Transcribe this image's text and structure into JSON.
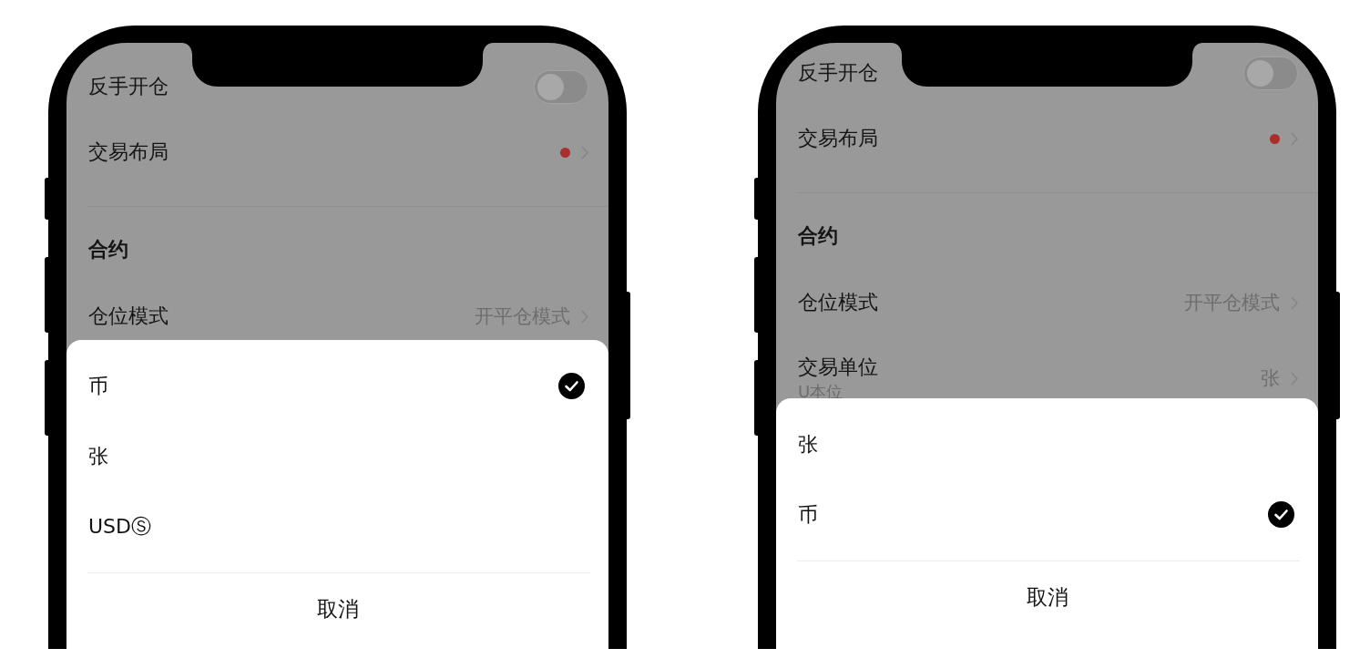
{
  "phones": [
    {
      "settings": [
        {
          "kind": "toggle",
          "label": "反手开仓",
          "on": false
        },
        {
          "kind": "link",
          "label": "交易布局",
          "dot": true
        },
        {
          "kind": "section",
          "label": "合约"
        },
        {
          "kind": "link",
          "label": "仓位模式",
          "value": "开平仓模式"
        }
      ],
      "sheet": {
        "options": [
          {
            "label": "币",
            "selected": true
          },
          {
            "label": "张",
            "selected": false
          },
          {
            "label": "USDⓈ",
            "selected": false
          }
        ],
        "cancel": "取消"
      }
    },
    {
      "settings": [
        {
          "kind": "toggle",
          "label": "反手开仓",
          "on": false
        },
        {
          "kind": "link",
          "label": "交易布局",
          "dot": true
        },
        {
          "kind": "section",
          "label": "合约"
        },
        {
          "kind": "link",
          "label": "仓位模式",
          "value": "开平仓模式"
        },
        {
          "kind": "link",
          "label": "交易单位",
          "subtitle": "U本位",
          "value": "张"
        }
      ],
      "sheet": {
        "options": [
          {
            "label": "张",
            "selected": false
          },
          {
            "label": "币",
            "selected": true
          }
        ],
        "cancel": "取消"
      }
    }
  ]
}
